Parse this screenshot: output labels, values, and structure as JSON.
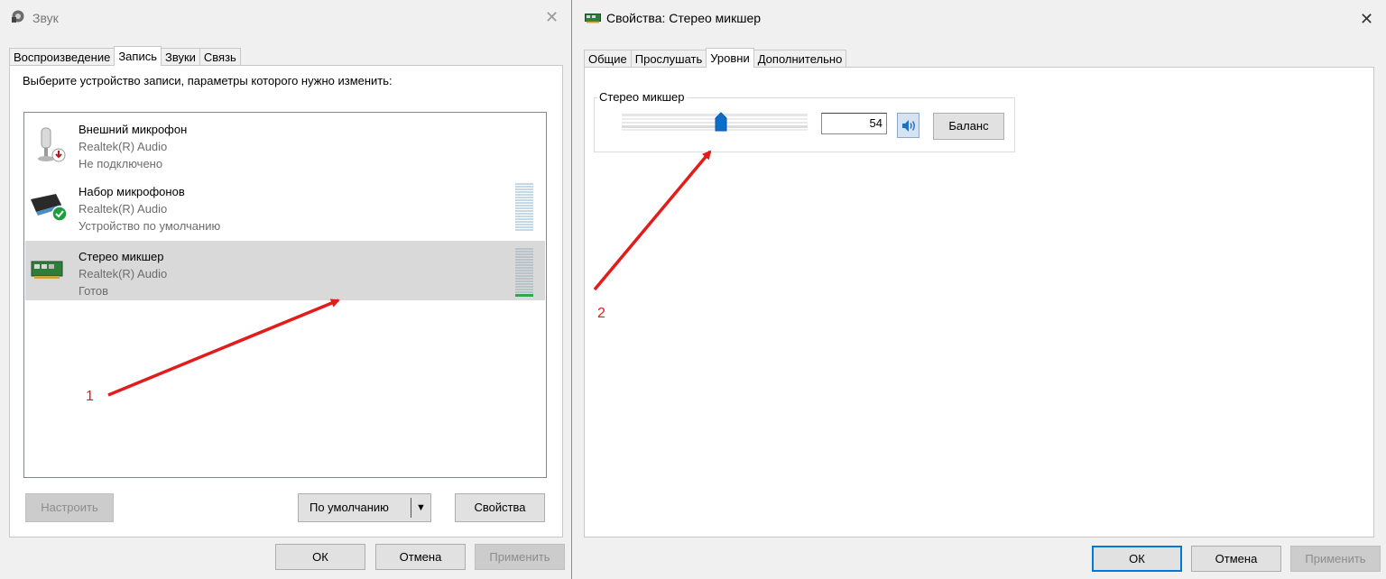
{
  "sound_window": {
    "title": "Звук",
    "tabs": [
      "Воспроизведение",
      "Запись",
      "Звуки",
      "Связь"
    ],
    "active_tab": 1,
    "instruction": "Выберите устройство записи, параметры которого нужно изменить:",
    "devices": [
      {
        "name": "Внешний микрофон",
        "driver": "Realtek(R) Audio",
        "status": "Не подключено"
      },
      {
        "name": "Набор микрофонов",
        "driver": "Realtek(R) Audio",
        "status": "Устройство по умолчанию"
      },
      {
        "name": "Стерео микшер",
        "driver": "Realtek(R) Audio",
        "status": "Готов"
      }
    ],
    "buttons": {
      "configure": "Настроить",
      "default": "По умолчанию",
      "properties": "Свойства",
      "ok": "ОК",
      "cancel": "Отмена",
      "apply": "Применить"
    }
  },
  "props_window": {
    "title": "Свойства: Стерео микшер",
    "tabs": [
      "Общие",
      "Прослушать",
      "Уровни",
      "Дополнительно"
    ],
    "active_tab": 2,
    "levels": {
      "group_label": "Стерео микшер",
      "value": "54",
      "balance_label": "Баланс"
    },
    "buttons": {
      "ok": "ОК",
      "cancel": "Отмена",
      "apply": "Применить"
    }
  },
  "annotations": {
    "label_1": "1",
    "label_2": "2",
    "color": "#e21b1b"
  }
}
